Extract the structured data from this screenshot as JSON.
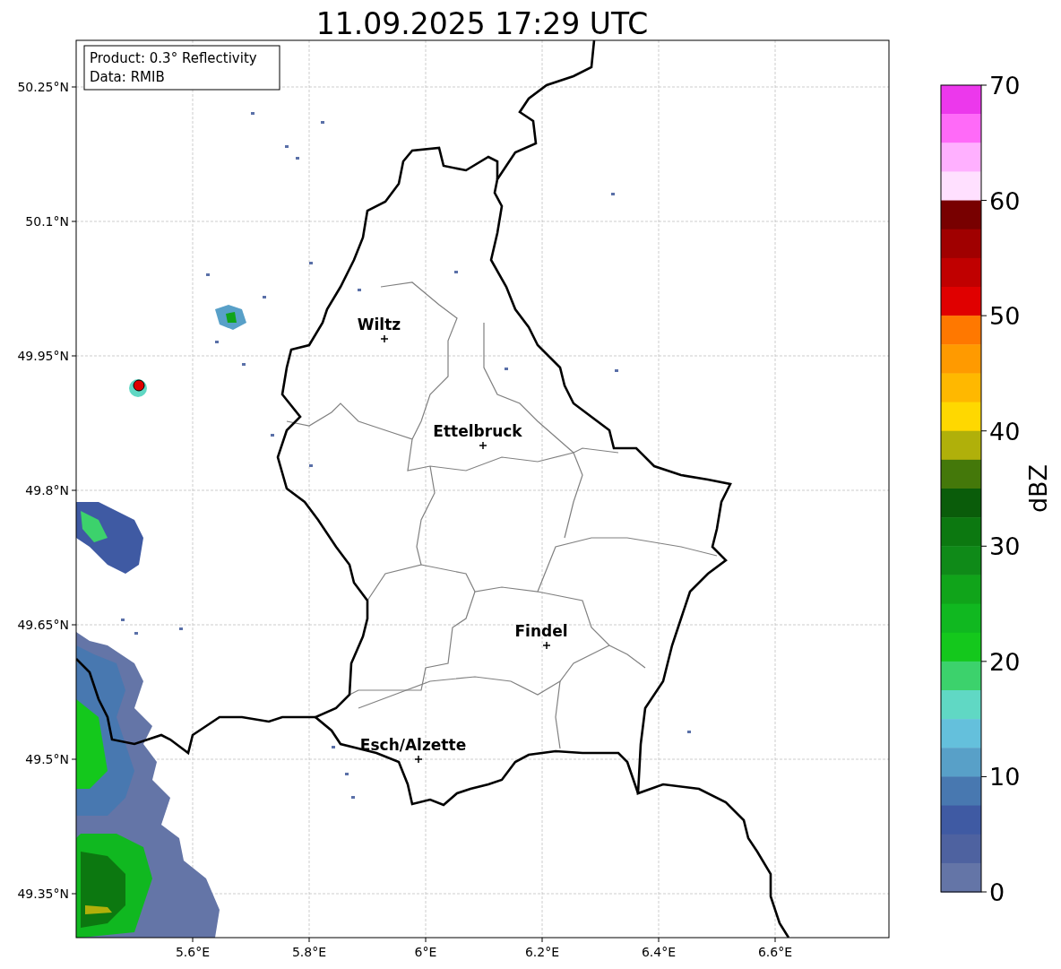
{
  "title": "11.09.2025 17:29 UTC",
  "map": {
    "legend": [
      "Product: 0.3° Reflectivity",
      "Data: RMIB"
    ],
    "y_ticks": [
      "50.25°N",
      "50.1°N",
      "49.95°N",
      "49.8°N",
      "49.65°N",
      "49.5°N",
      "49.35°N"
    ],
    "x_ticks": [
      "5.6°E",
      "5.8°E",
      "6°E",
      "6.2°E",
      "6.4°E",
      "6.6°E"
    ],
    "cities": [
      "Wiltz",
      "Ettelbruck",
      "Findel",
      "Esch/Alzette"
    ]
  },
  "colorbar": {
    "label": "dBZ",
    "ticks": [
      "70",
      "60",
      "50",
      "40",
      "30",
      "20",
      "10",
      "0"
    ],
    "segments": [
      {
        "color": "#ec38ec"
      },
      {
        "color": "#ff6af8"
      },
      {
        "color": "#ffb0ff"
      },
      {
        "color": "#ffe0ff"
      },
      {
        "color": "#780000"
      },
      {
        "color": "#a00000"
      },
      {
        "color": "#c00000"
      },
      {
        "color": "#e00000"
      },
      {
        "color": "#ff7800"
      },
      {
        "color": "#ff9a00"
      },
      {
        "color": "#ffb800"
      },
      {
        "color": "#ffd800"
      },
      {
        "color": "#b0b00a"
      },
      {
        "color": "#44780a"
      },
      {
        "color": "#0a5c0a"
      },
      {
        "color": "#0c7810"
      },
      {
        "color": "#0f8a18"
      },
      {
        "color": "#10a41a"
      },
      {
        "color": "#10b820"
      },
      {
        "color": "#14c81c"
      },
      {
        "color": "#3cd26c"
      },
      {
        "color": "#60d8c4"
      },
      {
        "color": "#64c0dc"
      },
      {
        "color": "#58a0c8"
      },
      {
        "color": "#4878b0"
      },
      {
        "color": "#3f5aa3"
      },
      {
        "color": "#4e62a0"
      },
      {
        "color": "#6475a7"
      }
    ]
  }
}
